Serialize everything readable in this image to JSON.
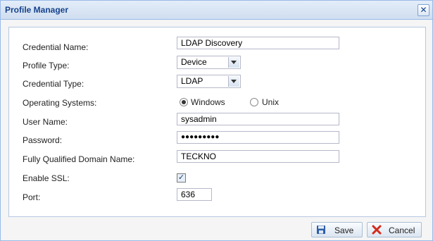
{
  "dialog": {
    "title": "Profile Manager",
    "close_glyph": "✕"
  },
  "form": {
    "credential_name": {
      "label": "Credential Name:",
      "value": "LDAP Discovery"
    },
    "profile_type": {
      "label": "Profile Type:",
      "value": "Device"
    },
    "credential_type": {
      "label": "Credential Type:",
      "value": "LDAP"
    },
    "operating_systems": {
      "label": "Operating Systems:",
      "options": [
        "Windows",
        "Unix"
      ],
      "selected": "Windows"
    },
    "user_name": {
      "label": "User Name:",
      "value": "sysadmin"
    },
    "password": {
      "label": "Password:",
      "value": "●●●●●●●●●"
    },
    "fqdn": {
      "label": "Fully Qualified Domain Name:",
      "value": "TECKNO"
    },
    "enable_ssl": {
      "label": "Enable SSL:",
      "checked": true,
      "check_glyph": "✓"
    },
    "port": {
      "label": "Port:",
      "value": "636"
    }
  },
  "footer": {
    "save_label": "Save",
    "cancel_label": "Cancel"
  },
  "icons": {
    "save": "floppy-disk-icon",
    "cancel": "red-x-icon"
  },
  "colors": {
    "title_text": "#15428b",
    "border": "#99bbe8"
  }
}
